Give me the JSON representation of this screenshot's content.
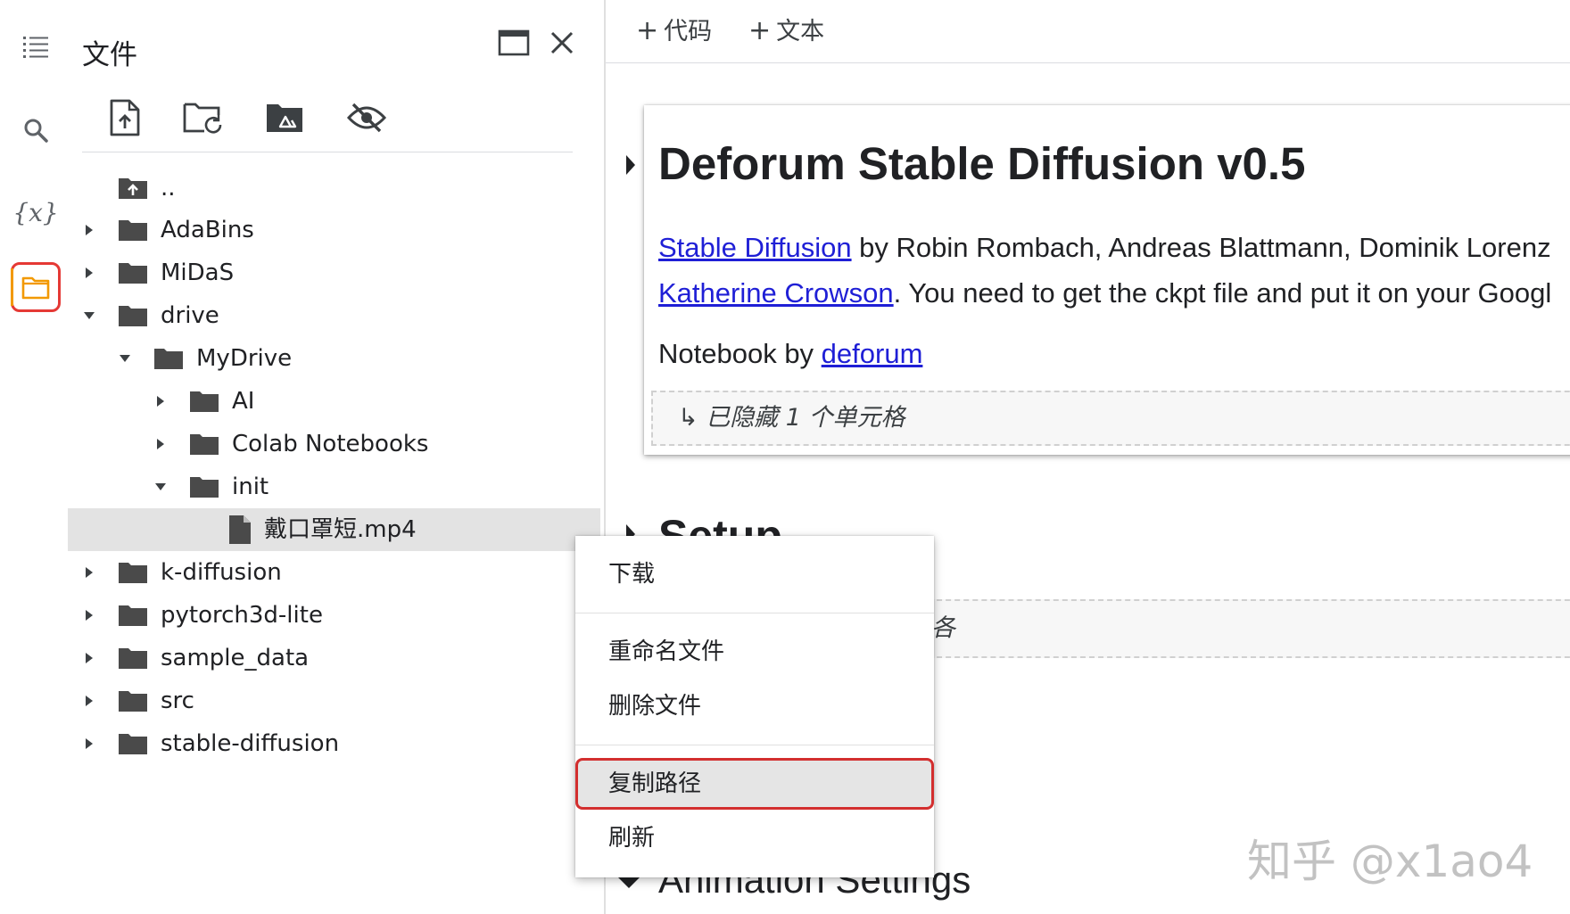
{
  "sidebar_rail": {
    "items": [
      {
        "name": "toc",
        "icon": "list-icon"
      },
      {
        "name": "search",
        "icon": "search-icon"
      },
      {
        "name": "variables",
        "icon": "variables-icon",
        "text": "{x}"
      },
      {
        "name": "files",
        "icon": "folder-icon",
        "active": true
      }
    ]
  },
  "files_panel": {
    "title": "文件",
    "toolbar": [
      "upload-file-icon",
      "refresh-folder-icon",
      "mount-drive-icon",
      "hide-eye-icon"
    ],
    "tree": [
      {
        "label": "..",
        "type": "parent"
      },
      {
        "label": "AdaBins",
        "type": "folder",
        "expanded": false
      },
      {
        "label": "MiDaS",
        "type": "folder",
        "expanded": false
      },
      {
        "label": "drive",
        "type": "folder",
        "expanded": true
      },
      {
        "label": "MyDrive",
        "type": "folder",
        "expanded": true
      },
      {
        "label": "AI",
        "type": "folder",
        "expanded": false
      },
      {
        "label": "Colab Notebooks",
        "type": "folder",
        "expanded": false
      },
      {
        "label": "init",
        "type": "folder",
        "expanded": true
      },
      {
        "label": "戴口罩短.mp4",
        "type": "file",
        "selected": true
      },
      {
        "label": "k-diffusion",
        "type": "folder",
        "expanded": false
      },
      {
        "label": "pytorch3d-lite",
        "type": "folder",
        "expanded": false
      },
      {
        "label": "sample_data",
        "type": "folder",
        "expanded": false
      },
      {
        "label": "src",
        "type": "folder",
        "expanded": false
      },
      {
        "label": "stable-diffusion",
        "type": "folder",
        "expanded": false
      }
    ]
  },
  "notebook": {
    "toolbar": {
      "add_code": "代码",
      "add_text": "文本"
    },
    "title": "Deforum Stable Diffusion v0.5",
    "intro_link1": "Stable Diffusion",
    "intro_line1_rest": " by Robin Rombach, Andreas Blattmann, Dominik Lorenz",
    "intro_link2": "Katherine Crowson",
    "intro_line2_rest": ". You need to get the ckpt file and put it on your Googl",
    "notebook_by": "Notebook by ",
    "notebook_by_link": "deforum",
    "hidden_cells": "↳ 已隐藏 1 个单元格",
    "setup_heading": "Setup",
    "setup_hidden_fragment": "各",
    "animation_heading": "Animation Settings"
  },
  "context_menu": {
    "items": [
      {
        "label": "下载"
      },
      {
        "label": "重命名文件"
      },
      {
        "label": "删除文件"
      },
      {
        "label": "复制路径",
        "highlighted": true
      },
      {
        "label": "刷新"
      }
    ]
  },
  "watermark": "知乎 @x1ao4",
  "colors": {
    "accent_orange": "#f29900",
    "highlight_red": "#d32f2f",
    "link_blue": "#1f1fd6",
    "selected_row": "#e3e3e3"
  }
}
